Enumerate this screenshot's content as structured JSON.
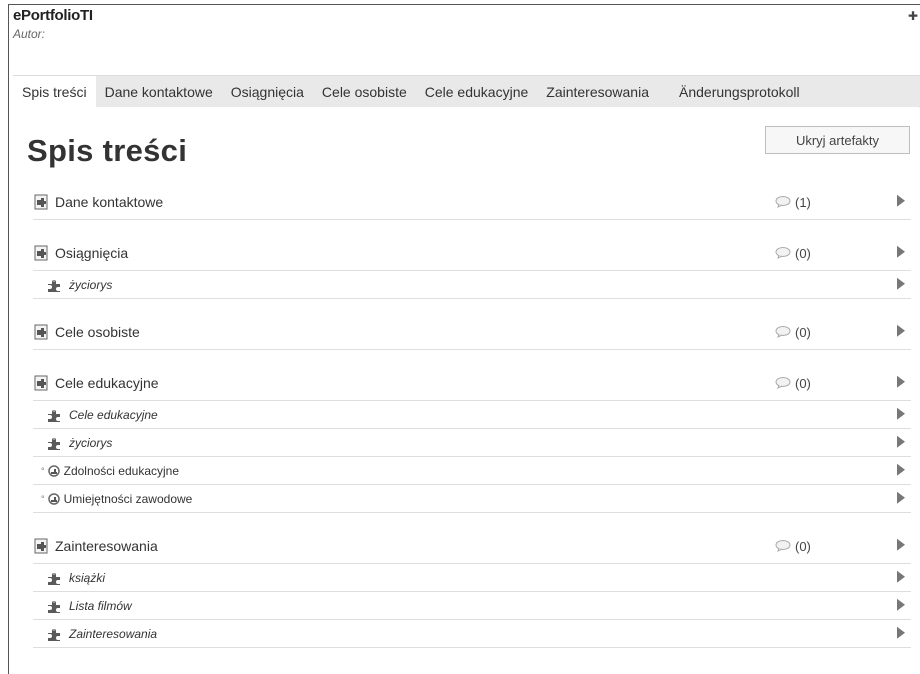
{
  "header": {
    "title": "ePortfolioTI",
    "author_label": "Autor:"
  },
  "tabs": [
    {
      "label": "Spis treści",
      "active": true
    },
    {
      "label": "Dane kontaktowe"
    },
    {
      "label": "Osiągnięcia"
    },
    {
      "label": "Cele osobiste"
    },
    {
      "label": "Cele edukacyjne"
    },
    {
      "label": "Zainteresowania"
    },
    {
      "label": "Änderungsprotokoll"
    }
  ],
  "main": {
    "title": "Spis treści",
    "hide_button": "Ukryj artefakty",
    "sections": [
      {
        "label": "Dane kontaktowe",
        "comments": "(1)",
        "items": []
      },
      {
        "label": "Osiągnięcia",
        "comments": "(0)",
        "items": [
          {
            "label": "życiorys",
            "type": "artefact"
          }
        ]
      },
      {
        "label": "Cele osobiste",
        "comments": "(0)",
        "items": []
      },
      {
        "label": "Cele edukacyjne",
        "comments": "(0)",
        "items": [
          {
            "label": "Cele edukacyjne",
            "type": "artefact"
          },
          {
            "label": "życiorys",
            "type": "artefact"
          },
          {
            "label": "Zdolności edukacyjne",
            "type": "competence"
          },
          {
            "label": "Umiejętności zawodowe",
            "type": "competence"
          }
        ]
      },
      {
        "label": "Zainteresowania",
        "comments": "(0)",
        "items": [
          {
            "label": "książki",
            "type": "artefact"
          },
          {
            "label": "Lista filmów",
            "type": "artefact"
          },
          {
            "label": "Zainteresowania",
            "type": "artefact"
          }
        ]
      }
    ]
  },
  "icons": {
    "section": "page-puzzle-icon",
    "artefact": "puzzle-icon",
    "competence": "competence-icon",
    "comments": "comment-bubble-icon",
    "arrow": "play-arrow-icon"
  }
}
